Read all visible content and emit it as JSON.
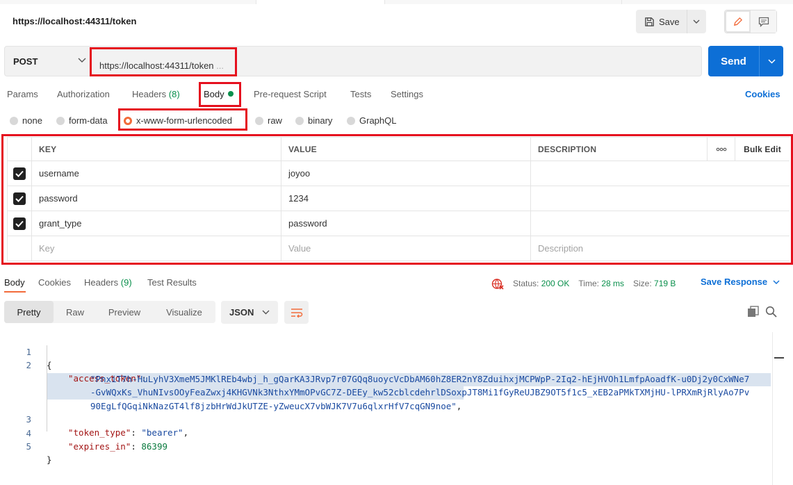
{
  "header": {
    "title": "https://localhost:44311/token",
    "save_label": "Save"
  },
  "request": {
    "method": "POST",
    "url": "https://localhost:44311/token",
    "url_ellipsis": "...",
    "send_label": "Send"
  },
  "request_tabs": {
    "params": "Params",
    "authorization": "Authorization",
    "headers": "Headers",
    "headers_count": "(8)",
    "body": "Body",
    "pre_request": "Pre-request Script",
    "tests": "Tests",
    "settings": "Settings",
    "cookies": "Cookies"
  },
  "body_types": {
    "none": "none",
    "form_data": "form-data",
    "urlencoded": "x-www-form-urlencoded",
    "raw": "raw",
    "binary": "binary",
    "graphql": "GraphQL",
    "selected": "x-www-form-urlencoded"
  },
  "params_table": {
    "headers": {
      "key": "KEY",
      "value": "VALUE",
      "description": "DESCRIPTION",
      "more": "ooo",
      "bulk_edit": "Bulk Edit"
    },
    "rows": [
      {
        "key": "username",
        "value": "joyoo",
        "description": ""
      },
      {
        "key": "password",
        "value": "1234",
        "description": ""
      },
      {
        "key": "grant_type",
        "value": "password",
        "description": ""
      }
    ],
    "placeholder": {
      "key": "Key",
      "value": "Value",
      "description": "Description"
    }
  },
  "response_tabs": {
    "body": "Body",
    "cookies": "Cookies",
    "headers": "Headers",
    "headers_count": "(9)",
    "test_results": "Test Results"
  },
  "response_status": {
    "status_label": "Status:",
    "status_value": "200 OK",
    "time_label": "Time:",
    "time_value": "28 ms",
    "size_label": "Size:",
    "size_value": "719 B",
    "save_response": "Save Response"
  },
  "view_tabs": {
    "pretty": "Pretty",
    "raw": "Raw",
    "preview": "Preview",
    "visualize": "Visualize",
    "format": "JSON"
  },
  "response_body": {
    "line_numbers": [
      "1",
      "2",
      "3",
      "4",
      "5"
    ],
    "open_brace": "{",
    "close_brace": "}",
    "access_token_key": "\"access_token\"",
    "access_token_line1": "\"PnxiT7h-HuLyhV3XmeM5JMKlREb4wbj_h_gQarKA3JRvp7r07GQq8uoycVcDbAM60hZ8ER2nY8ZduihxjMCPWpP-2Iq2-hEjHVOh1LmfpAoadfK-u0Dj2y0CxWNe7",
    "access_token_line2": "-GvWQxKs_VhuNIvsOOyFeaZwxj4KHGVNk3NthxYMmOPvGC7Z-DEEy_kw52cblcdehrlDSoxpJT8Mi1fGyReUJBZ9OT5f1c5_xEB2aPMkTXMjHU-lPRXmRjRlyAo7Pv",
    "access_token_line3": "90EgLfQGqiNkNazGT4lf8jzbHrWdJkUTZE-yZweucX7vbWJK7V7u6qlxrHfV7cqGN9noe\"",
    "token_type_key": "\"token_type\"",
    "token_type_value": "\"bearer\"",
    "expires_in_key": "\"expires_in\"",
    "expires_in_value": "86399"
  }
}
